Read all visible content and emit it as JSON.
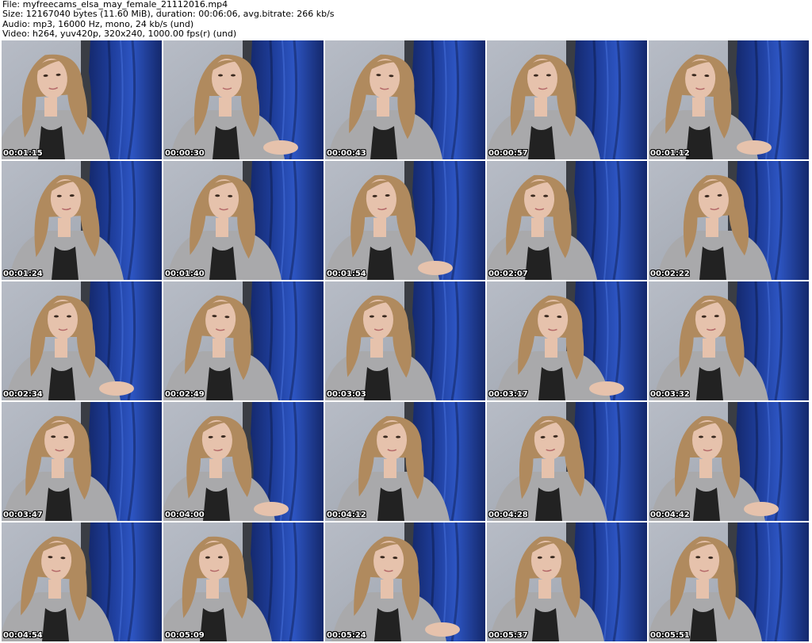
{
  "header": {
    "file": "File: myfreecams_elsa_may_female_21112016.mp4",
    "size": "Size: 12167040 bytes (11.60 MiB), duration: 00:06:06, avg.bitrate: 266 kb/s",
    "audio": "Audio: mp3, 16000 Hz, mono, 24 kb/s (und)",
    "video": "Video: h264, yuv420p, 320x240, 1000.00 fps(r) (und)"
  },
  "colors": {
    "wall": "#9aa0aa",
    "curtain": "#1f3f9e",
    "curtain_dark": "#14286b",
    "hair": "#b08a5e",
    "skin": "#e6c2ac",
    "sweater": "#a9a9ab",
    "top": "#222222"
  },
  "thumbnails": [
    {
      "time": "00:01:15"
    },
    {
      "time": "00:00:30"
    },
    {
      "time": "00:00:43"
    },
    {
      "time": "00:00:57"
    },
    {
      "time": "00:01:12"
    },
    {
      "time": "00:01:24"
    },
    {
      "time": "00:01:40"
    },
    {
      "time": "00:01:54"
    },
    {
      "time": "00:02:07"
    },
    {
      "time": "00:02:22"
    },
    {
      "time": "00:02:34"
    },
    {
      "time": "00:02:49"
    },
    {
      "time": "00:03:03"
    },
    {
      "time": "00:03:17"
    },
    {
      "time": "00:03:32"
    },
    {
      "time": "00:03:47"
    },
    {
      "time": "00:04:00"
    },
    {
      "time": "00:04:12"
    },
    {
      "time": "00:04:28"
    },
    {
      "time": "00:04:42"
    },
    {
      "time": "00:04:54"
    },
    {
      "time": "00:05:09"
    },
    {
      "time": "00:05:24"
    },
    {
      "time": "00:05:37"
    },
    {
      "time": "00:05:51"
    }
  ]
}
